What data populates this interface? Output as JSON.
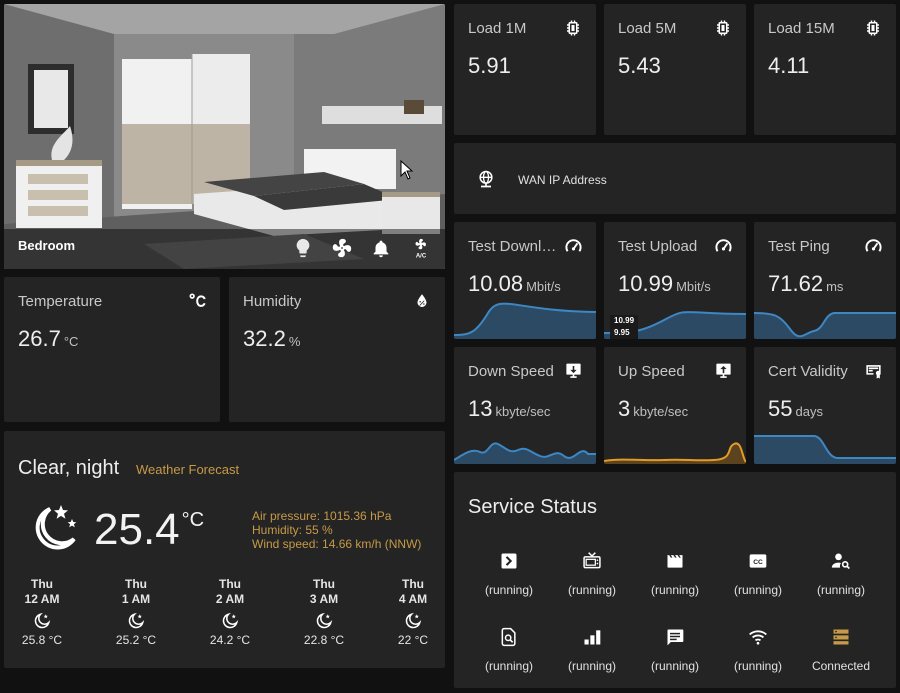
{
  "colors": {
    "card_bg": "#242424",
    "page_bg": "#111111",
    "accent_gold": "#c69a47",
    "spark_blue_line": "#3e87c5",
    "spark_blue_fill": "#2c4a63",
    "spark_orange_line": "#e39a26",
    "spark_orange_fill": "#5b4320"
  },
  "picture": {
    "name": "Bedroom",
    "controls": [
      "lightbulb-icon",
      "fan-icon",
      "bell-icon",
      "air-conditioner-icon"
    ]
  },
  "temperature": {
    "name": "Temperature",
    "value": "26.7",
    "unit": "°C",
    "icon": "celsius-icon"
  },
  "humidity": {
    "name": "Humidity",
    "value": "32.2",
    "unit": "%",
    "icon": "water-percent-icon"
  },
  "weather": {
    "condition": "Clear, night",
    "name": "Weather Forecast",
    "icon": "moon-stars-icon",
    "temperature": "25.4",
    "unit": "°C",
    "air_pressure": "Air pressure: 1015.36 hPa",
    "humidity": "Humidity: 55 %",
    "wind": "Wind speed: 14.66 km/h (NNW)",
    "forecast": [
      {
        "day": "Thu",
        "time": "12 AM",
        "icon": "moon-icon",
        "temp": "25.8 °C"
      },
      {
        "day": "Thu",
        "time": "1 AM",
        "icon": "moon-icon",
        "temp": "25.2 °C"
      },
      {
        "day": "Thu",
        "time": "2 AM",
        "icon": "moon-icon",
        "temp": "24.2 °C"
      },
      {
        "day": "Thu",
        "time": "3 AM",
        "icon": "moon-icon",
        "temp": "22.8 °C"
      },
      {
        "day": "Thu",
        "time": "4 AM",
        "icon": "moon-icon",
        "temp": "22 °C"
      }
    ]
  },
  "load": [
    {
      "name": "Load 1M",
      "value": "5.91",
      "icon": "cpu-icon"
    },
    {
      "name": "Load 5M",
      "value": "5.43",
      "icon": "cpu-icon"
    },
    {
      "name": "Load 15M",
      "value": "4.11",
      "icon": "cpu-icon"
    }
  ],
  "wan": {
    "name": "WAN IP Address",
    "icon": "globe-icon"
  },
  "speedtest": [
    {
      "name": "Test Downl…",
      "value": "10.08",
      "unit": "Mbit/s",
      "icon": "speedometer-icon"
    },
    {
      "name": "Test Upload",
      "value": "10.99",
      "unit": "Mbit/s",
      "icon": "speedometer-icon",
      "hover_max": "10.99",
      "hover_min": "9.95"
    },
    {
      "name": "Test Ping",
      "value": "71.62",
      "unit": "ms",
      "icon": "speedometer-icon"
    }
  ],
  "speeds": [
    {
      "name": "Down Speed",
      "value": "13",
      "unit": "kbyte/sec",
      "icon": "download-network-icon"
    },
    {
      "name": "Up Speed",
      "value": "3",
      "unit": "kbyte/sec",
      "icon": "upload-network-icon"
    },
    {
      "name": "Cert Validity",
      "value": "55",
      "unit": "days",
      "icon": "certificate-icon"
    }
  ],
  "service_status": {
    "title": "Service Status",
    "items": [
      {
        "icon": "console-icon",
        "state": "(running)"
      },
      {
        "icon": "tv-icon",
        "state": "(running)"
      },
      {
        "icon": "movie-icon",
        "state": "(running)"
      },
      {
        "icon": "closed-caption-icon",
        "state": "(running)"
      },
      {
        "icon": "account-search-icon",
        "state": "(running)"
      },
      {
        "icon": "file-search-icon",
        "state": "(running)"
      },
      {
        "icon": "signal-bars-icon",
        "state": "(running)"
      },
      {
        "icon": "message-text-icon",
        "state": "(running)"
      },
      {
        "icon": "wifi-icon",
        "state": "(running)"
      },
      {
        "icon": "server-icon",
        "state": "Connected"
      }
    ]
  }
}
